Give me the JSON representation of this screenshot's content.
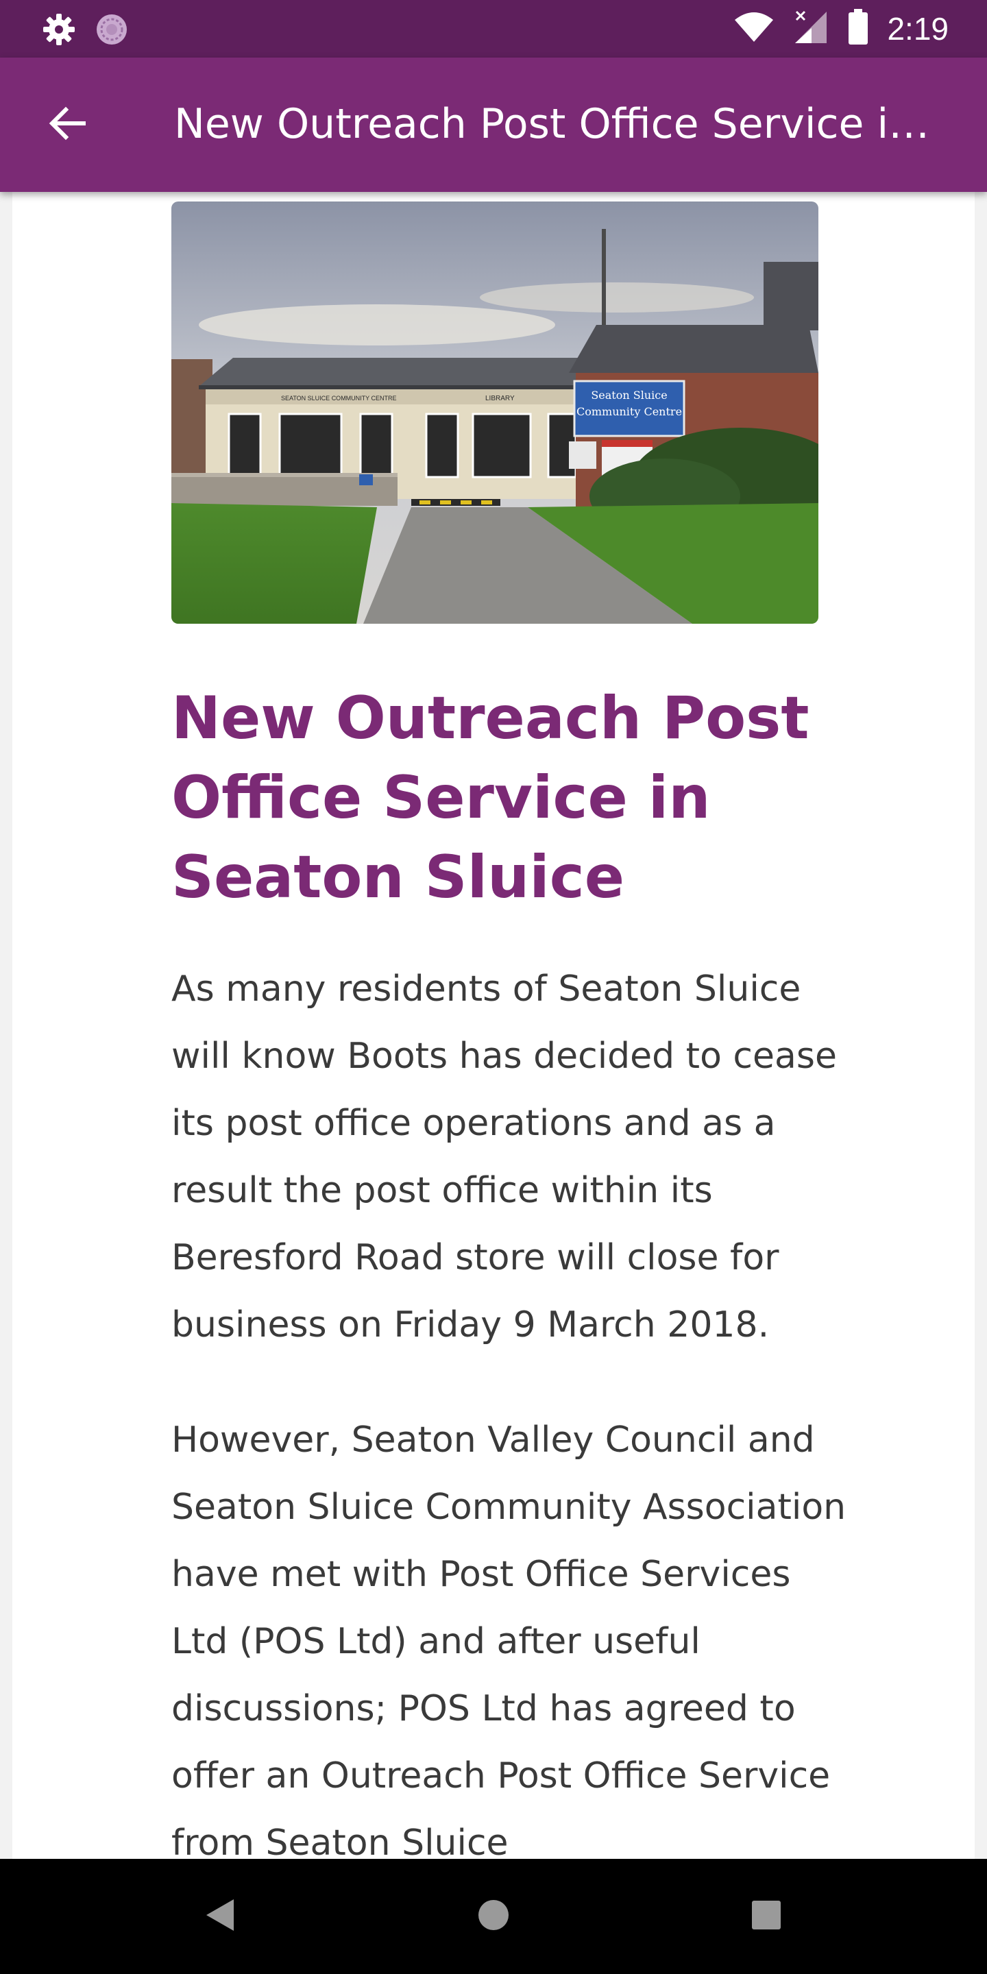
{
  "status_bar": {
    "time": "2:19",
    "icons": [
      "gear-icon",
      "sync-icon",
      "wifi-icon",
      "cell-signal-icon",
      "battery-icon"
    ]
  },
  "app_bar": {
    "title": "New Outreach Post Office Service i…",
    "back_icon": "arrow-left-icon"
  },
  "article": {
    "image": {
      "sign_main": "Seaton Sluice",
      "sign_sub": "Community Centre",
      "facade_left": "SEATON SLUICE COMMUNITY CENTRE",
      "facade_right": "LIBRARY"
    },
    "title": "New Outreach Post Office Service in Seaton Sluice",
    "paragraphs": [
      "As many residents of Seaton Sluice will know Boots has decided to cease its post office operations and as a result the post office within its Beresford Road store will close for business on Friday 9 March 2018.",
      "However, Seaton Valley Council and Seaton Sluice Community Association have met with Post Office Services Ltd (POS Ltd) and after useful discussions; POS Ltd has agreed to offer an Outreach Post Office Service from Seaton Sluice"
    ]
  },
  "nav_bar": {
    "icons": [
      "back-triangle-icon",
      "home-circle-icon",
      "recents-square-icon"
    ]
  },
  "colors": {
    "status_bar": "#5e1f5c",
    "app_bar": "#7b2a75",
    "title_text": "#7b2a75",
    "body_text": "#3a3a3a"
  }
}
